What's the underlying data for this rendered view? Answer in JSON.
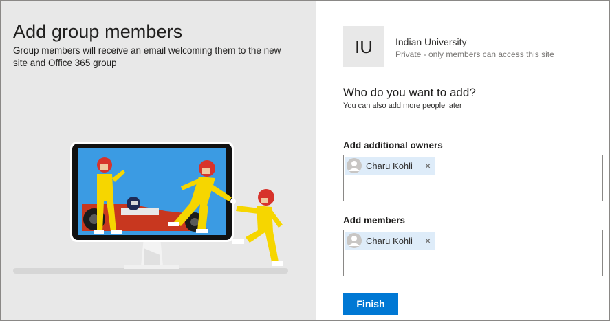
{
  "left": {
    "title": "Add group members",
    "description": "Group members will receive an email welcoming them to the new site and Office 365 group"
  },
  "site": {
    "initials": "IU",
    "name": "Indian University",
    "privacy": "Private - only members can access this site"
  },
  "prompt": {
    "title": "Who do you want to add?",
    "subtitle": "You can also add more people later"
  },
  "owners": {
    "label": "Add additional owners",
    "people": [
      {
        "name": "Charu Kohli",
        "remove_icon": "×"
      }
    ]
  },
  "members": {
    "label": "Add members",
    "people": [
      {
        "name": "Charu Kohli",
        "remove_icon": "×"
      }
    ]
  },
  "finish_label": "Finish",
  "colors": {
    "accent": "#0078d4",
    "persona_bg": "#deecf9",
    "left_bg": "#e8e8e8"
  }
}
